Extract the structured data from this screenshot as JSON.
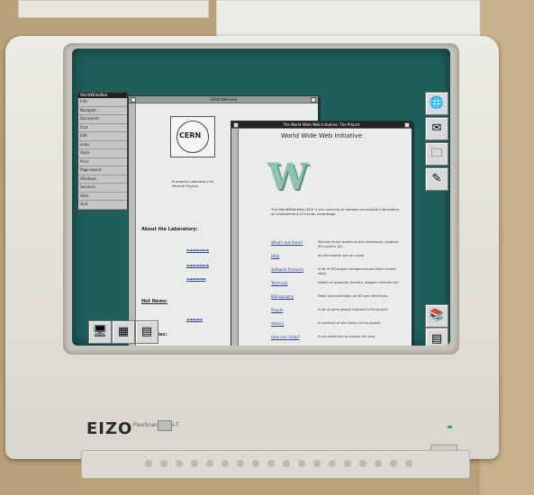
{
  "menu": {
    "title": "WorldWideWeb",
    "items": [
      "Info",
      "Navigate",
      "Document",
      "Find",
      "Edit",
      "Links",
      "Style",
      "Print",
      "Page layout",
      "Windows",
      "Services",
      "Hide",
      "Quit"
    ]
  },
  "windows": {
    "cern": {
      "title": "CERN Welcome",
      "logo_text": "CERN",
      "intro": "European Laboratory for Particle Physics",
      "about_heading": "About the Laboratory:",
      "news_heading": "Hot News:",
      "activities_heading": "Activities:"
    },
    "www": {
      "title": "The World Wide Web Initiative: The Project",
      "heading": "World Wide Web Initiative",
      "logo_letter": "W",
      "intro": "The WorldWideWeb (W3) is the universe of network-accessible information, an embodiment of human knowledge.",
      "rows": [
        {
          "label": "What's out there?",
          "text": "Pointers to the world's online information, subjects, W3 servers, etc."
        },
        {
          "label": "Help",
          "text": "on the browser you are using"
        },
        {
          "label": "Software Products",
          "text": "A list of W3 project components and their current state."
        },
        {
          "label": "Technical",
          "text": "Details of protocols, formats, program internals etc"
        },
        {
          "label": "Bibliography",
          "text": "Paper documentation on W3 and references."
        },
        {
          "label": "People",
          "text": "A list of some people involved in the project."
        },
        {
          "label": "History",
          "text": "A summary of the history of the project."
        },
        {
          "label": "How can I help?",
          "text": "If you would like to support the web.."
        }
      ]
    }
  },
  "monitor": {
    "brand": "EIZO",
    "model": "FlexScan T560i-T"
  },
  "dock": [
    "globe-icon",
    "mail-icon",
    "folder-icon",
    "pen-icon",
    "books-icon",
    "terminal-icon",
    "recycler-icon"
  ],
  "dock_glyphs": [
    "🌐",
    "✉",
    "🗀",
    "✎",
    "📚",
    "▤",
    "♻"
  ]
}
